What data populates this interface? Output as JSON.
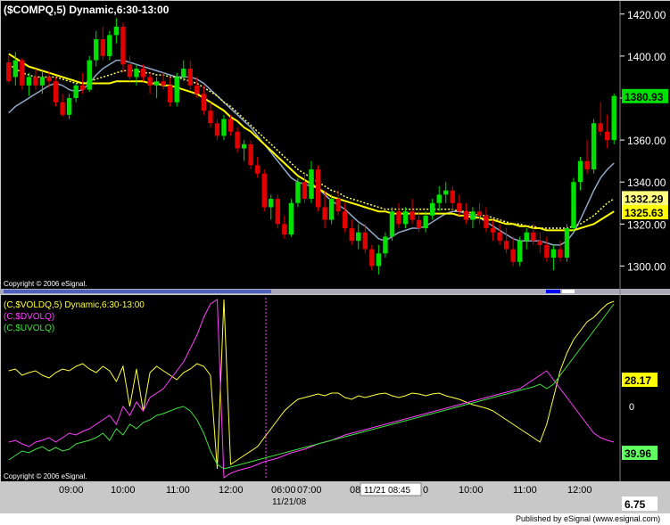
{
  "footer": {
    "published": "Published by eSignal (www.esignal.com)"
  },
  "chart_data": [
    {
      "type": "candlestick",
      "title": "($COMPQ,5) Dynamic,6:30-13:00",
      "copyright": "Copyright © 2006 eSignal.",
      "ylim": [
        1290,
        1425
      ],
      "y_ticks": [
        1300,
        1320,
        1340,
        1360,
        1380,
        1400,
        1420
      ],
      "y_tick_labels": [
        "1300.00",
        "1320.00",
        "1340.00",
        "1360.00",
        "1380.00",
        "1400.00",
        "1420.00"
      ],
      "price_labels": [
        {
          "text": "1380.93",
          "value": 1380.93,
          "bg": "#00e000",
          "fg": "#000000"
        },
        {
          "text": "1332.29",
          "value": 1332.29,
          "bg": "#ffff80",
          "fg": "#000000"
        },
        {
          "text": "1325.63",
          "value": 1325.63,
          "bg": "#ffff00",
          "fg": "#000000"
        }
      ],
      "candles": [
        [
          1397,
          1400,
          1387,
          1388
        ],
        [
          1390,
          1402,
          1386,
          1398
        ],
        [
          1398,
          1399,
          1384,
          1386
        ],
        [
          1386,
          1392,
          1381,
          1390
        ],
        [
          1390,
          1394,
          1384,
          1386
        ],
        [
          1386,
          1393,
          1382,
          1390
        ],
        [
          1390,
          1393,
          1385,
          1388
        ],
        [
          1388,
          1390,
          1376,
          1378
        ],
        [
          1378,
          1382,
          1371,
          1372
        ],
        [
          1372,
          1382,
          1370,
          1380
        ],
        [
          1380,
          1387,
          1378,
          1386
        ],
        [
          1386,
          1392,
          1382,
          1384
        ],
        [
          1384,
          1400,
          1383,
          1398
        ],
        [
          1398,
          1412,
          1395,
          1408
        ],
        [
          1408,
          1414,
          1398,
          1400
        ],
        [
          1400,
          1412,
          1398,
          1410
        ],
        [
          1410,
          1418,
          1406,
          1414
        ],
        [
          1414,
          1416,
          1392,
          1396
        ],
        [
          1396,
          1400,
          1388,
          1390
        ],
        [
          1390,
          1396,
          1386,
          1394
        ],
        [
          1394,
          1396,
          1388,
          1390
        ],
        [
          1390,
          1392,
          1382,
          1386
        ],
        [
          1386,
          1390,
          1380,
          1388
        ],
        [
          1388,
          1392,
          1384,
          1386
        ],
        [
          1386,
          1390,
          1376,
          1378
        ],
        [
          1378,
          1392,
          1376,
          1390
        ],
        [
          1390,
          1398,
          1388,
          1394
        ],
        [
          1394,
          1398,
          1384,
          1386
        ],
        [
          1386,
          1390,
          1380,
          1382
        ],
        [
          1382,
          1386,
          1372,
          1374
        ],
        [
          1374,
          1378,
          1366,
          1368
        ],
        [
          1368,
          1370,
          1360,
          1362
        ],
        [
          1362,
          1372,
          1360,
          1370
        ],
        [
          1370,
          1372,
          1362,
          1364
        ],
        [
          1364,
          1366,
          1354,
          1356
        ],
        [
          1356,
          1360,
          1350,
          1358
        ],
        [
          1358,
          1360,
          1346,
          1348
        ],
        [
          1348,
          1352,
          1342,
          1344
        ],
        [
          1344,
          1346,
          1326,
          1328
        ],
        [
          1328,
          1334,
          1322,
          1332
        ],
        [
          1332,
          1334,
          1318,
          1320
        ],
        [
          1320,
          1324,
          1313,
          1315
        ],
        [
          1315,
          1332,
          1314,
          1330
        ],
        [
          1330,
          1342,
          1328,
          1340
        ],
        [
          1340,
          1344,
          1330,
          1332
        ],
        [
          1332,
          1350,
          1330,
          1346
        ],
        [
          1346,
          1348,
          1326,
          1328
        ],
        [
          1328,
          1336,
          1318,
          1322
        ],
        [
          1322,
          1334,
          1320,
          1332
        ],
        [
          1332,
          1336,
          1324,
          1326
        ],
        [
          1326,
          1330,
          1316,
          1318
        ],
        [
          1318,
          1322,
          1310,
          1312
        ],
        [
          1312,
          1320,
          1308,
          1316
        ],
        [
          1316,
          1320,
          1306,
          1308
        ],
        [
          1308,
          1310,
          1298,
          1300
        ],
        [
          1300,
          1310,
          1296,
          1306
        ],
        [
          1306,
          1316,
          1304,
          1314
        ],
        [
          1314,
          1328,
          1312,
          1326
        ],
        [
          1326,
          1330,
          1318,
          1320
        ],
        [
          1320,
          1328,
          1318,
          1326
        ],
        [
          1326,
          1332,
          1320,
          1322
        ],
        [
          1322,
          1326,
          1316,
          1318
        ],
        [
          1318,
          1326,
          1316,
          1324
        ],
        [
          1324,
          1332,
          1322,
          1330
        ],
        [
          1330,
          1338,
          1326,
          1334
        ],
        [
          1334,
          1340,
          1330,
          1336
        ],
        [
          1336,
          1338,
          1326,
          1330
        ],
        [
          1330,
          1334,
          1324,
          1326
        ],
        [
          1326,
          1330,
          1320,
          1322
        ],
        [
          1322,
          1328,
          1318,
          1326
        ],
        [
          1326,
          1330,
          1320,
          1324
        ],
        [
          1324,
          1328,
          1316,
          1318
        ],
        [
          1318,
          1322,
          1312,
          1316
        ],
        [
          1316,
          1320,
          1310,
          1312
        ],
        [
          1312,
          1318,
          1306,
          1308
        ],
        [
          1308,
          1314,
          1300,
          1302
        ],
        [
          1302,
          1314,
          1300,
          1312
        ],
        [
          1312,
          1318,
          1308,
          1316
        ],
        [
          1316,
          1320,
          1310,
          1312
        ],
        [
          1312,
          1316,
          1306,
          1310
        ],
        [
          1310,
          1314,
          1302,
          1304
        ],
        [
          1304,
          1310,
          1298,
          1308
        ],
        [
          1308,
          1312,
          1302,
          1304
        ],
        [
          1304,
          1320,
          1302,
          1318
        ],
        [
          1318,
          1342,
          1316,
          1340
        ],
        [
          1340,
          1352,
          1336,
          1350
        ],
        [
          1350,
          1360,
          1344,
          1346
        ],
        [
          1346,
          1370,
          1344,
          1368
        ],
        [
          1368,
          1378,
          1362,
          1364
        ],
        [
          1364,
          1372,
          1356,
          1360
        ],
        [
          1360,
          1382,
          1358,
          1381
        ]
      ],
      "ma_fast": [
        1373,
        1376,
        1378,
        1380,
        1382,
        1384,
        1386,
        1387,
        1386,
        1384,
        1383,
        1384,
        1387,
        1391,
        1394,
        1396,
        1398,
        1398,
        1397,
        1396,
        1395,
        1394,
        1393,
        1392,
        1391,
        1390,
        1390,
        1390,
        1389,
        1387,
        1384,
        1381,
        1378,
        1375,
        1372,
        1369,
        1366,
        1362,
        1358,
        1354,
        1350,
        1346,
        1342,
        1340,
        1339,
        1338,
        1337,
        1334,
        1331,
        1329,
        1327,
        1324,
        1321,
        1319,
        1316,
        1313,
        1312,
        1314,
        1316,
        1317,
        1318,
        1318,
        1319,
        1321,
        1323,
        1325,
        1326,
        1326,
        1325,
        1324,
        1323,
        1321,
        1319,
        1317,
        1315,
        1313,
        1312,
        1312,
        1312,
        1312,
        1311,
        1310,
        1310,
        1312,
        1316,
        1322,
        1329,
        1336,
        1342,
        1346,
        1349
      ],
      "ma_mid_dotted": [
        1396,
        1394,
        1392,
        1391,
        1390,
        1390,
        1390,
        1390,
        1389,
        1388,
        1387,
        1387,
        1388,
        1389,
        1390,
        1391,
        1392,
        1393,
        1393,
        1393,
        1392,
        1392,
        1391,
        1391,
        1390,
        1390,
        1389,
        1388,
        1387,
        1385,
        1383,
        1381,
        1378,
        1376,
        1373,
        1370,
        1367,
        1364,
        1361,
        1358,
        1355,
        1352,
        1349,
        1346,
        1344,
        1342,
        1340,
        1338,
        1336,
        1335,
        1333,
        1332,
        1331,
        1330,
        1329,
        1328,
        1327,
        1327,
        1327,
        1327,
        1327,
        1327,
        1327,
        1327,
        1327,
        1327,
        1327,
        1326,
        1326,
        1325,
        1324,
        1324,
        1323,
        1322,
        1321,
        1320,
        1320,
        1319,
        1319,
        1318,
        1318,
        1318,
        1318,
        1318,
        1319,
        1320,
        1322,
        1324,
        1327,
        1330,
        1332
      ],
      "ma_slow": [
        1401,
        1399,
        1397,
        1395,
        1394,
        1393,
        1392,
        1391,
        1390,
        1389,
        1388,
        1387,
        1387,
        1387,
        1387,
        1387,
        1388,
        1388,
        1388,
        1388,
        1388,
        1387,
        1387,
        1386,
        1386,
        1385,
        1384,
        1383,
        1382,
        1380,
        1378,
        1376,
        1374,
        1371,
        1369,
        1366,
        1364,
        1361,
        1358,
        1355,
        1352,
        1349,
        1346,
        1343,
        1341,
        1339,
        1337,
        1335,
        1333,
        1332,
        1331,
        1330,
        1329,
        1328,
        1327,
        1326,
        1326,
        1325,
        1325,
        1325,
        1325,
        1325,
        1325,
        1325,
        1325,
        1325,
        1325,
        1324,
        1324,
        1323,
        1323,
        1322,
        1322,
        1321,
        1320,
        1320,
        1319,
        1319,
        1318,
        1318,
        1317,
        1317,
        1317,
        1317,
        1317,
        1318,
        1319,
        1320,
        1322,
        1324,
        1326
      ]
    },
    {
      "type": "line",
      "title": "(C,$VOLDQ,5) Dynamic,6:30-13:00",
      "copyright": "Copyright © 2006 eSignal.",
      "ylim": [
        -100,
        100
      ],
      "y_tick_labels": [
        "0"
      ],
      "value_labels": [
        {
          "text": "28.17",
          "bg": "#ffff00",
          "fg": "#000000"
        },
        {
          "text": "39.96",
          "bg": "#60ff60",
          "fg": "#000000"
        },
        {
          "text": "6.75",
          "bg": "#ffffff",
          "fg": "#000000"
        }
      ],
      "series": [
        {
          "name": "(C,$VOLDQ,5) Dynamic,6:30-13:00",
          "color": "#ffff40",
          "values": [
            20,
            22,
            15,
            18,
            20,
            15,
            12,
            18,
            22,
            20,
            25,
            28,
            22,
            18,
            25,
            20,
            8,
            25,
            -20,
            22,
            -25,
            18,
            25,
            20,
            15,
            10,
            18,
            22,
            28,
            25,
            15,
            -90,
            100,
            -85,
            -80,
            -75,
            -70,
            -65,
            -55,
            -45,
            -35,
            -25,
            -18,
            -12,
            -10,
            -8,
            -6,
            -8,
            -5,
            -5,
            -10,
            -12,
            -8,
            -10,
            -8,
            -6,
            -5,
            -8,
            -10,
            -8,
            -5,
            -6,
            -8,
            -6,
            -5,
            -8,
            -10,
            -12,
            -15,
            -18,
            -20,
            -22,
            -25,
            -30,
            -35,
            -40,
            -45,
            -50,
            -55,
            -60,
            -40,
            -10,
            20,
            40,
            55,
            65,
            75,
            80,
            88,
            95,
            98
          ]
        },
        {
          "name": "(C,$DVOLQ)",
          "color": "#ff40ff",
          "values": [
            -60,
            -58,
            -62,
            -65,
            -60,
            -58,
            -55,
            -60,
            -55,
            -50,
            -52,
            -48,
            -45,
            -40,
            -35,
            -30,
            -40,
            -20,
            -30,
            -15,
            -25,
            -10,
            -5,
            0,
            10,
            20,
            30,
            45,
            60,
            80,
            95,
            100,
            -100,
            -95,
            -92,
            -90,
            -88,
            -85,
            -82,
            -80,
            -78,
            -75,
            -72,
            -70,
            -68,
            -65,
            -62,
            -60,
            -58,
            -55,
            -52,
            -50,
            -48,
            -46,
            -44,
            -42,
            -40,
            -38,
            -36,
            -34,
            -32,
            -30,
            -28,
            -26,
            -24,
            -22,
            -20,
            -18,
            -16,
            -14,
            -12,
            -10,
            -8,
            -6,
            -4,
            -2,
            0,
            5,
            10,
            15,
            20,
            10,
            0,
            -10,
            -20,
            -30,
            -40,
            -50,
            -55,
            -58,
            -60
          ]
        },
        {
          "name": "(C,$UVOLQ)",
          "color": "#40e040",
          "values": [
            -80,
            -75,
            -70,
            -72,
            -68,
            -65,
            -70,
            -66,
            -70,
            -68,
            -62,
            -60,
            -58,
            -55,
            -50,
            -58,
            -45,
            -52,
            -40,
            -45,
            -38,
            -35,
            -30,
            -28,
            -25,
            -22,
            -20,
            -25,
            -35,
            -50,
            -70,
            -85,
            -90,
            -88,
            -86,
            -84,
            -82,
            -80,
            -78,
            -76,
            -74,
            -72,
            -70,
            -68,
            -66,
            -64,
            -62,
            -60,
            -58,
            -56,
            -54,
            -52,
            -50,
            -48,
            -46,
            -44,
            -42,
            -40,
            -38,
            -36,
            -34,
            -32,
            -30,
            -28,
            -26,
            -24,
            -22,
            -20,
            -18,
            -16,
            -14,
            -12,
            -10,
            -8,
            -6,
            -4,
            -2,
            0,
            2,
            5,
            0,
            5,
            15,
            25,
            35,
            45,
            55,
            65,
            75,
            85,
            95
          ]
        }
      ]
    }
  ],
  "time_axis": {
    "labels": [
      "09:00",
      "10:00",
      "11:00",
      "12:00",
      "06:00",
      "07:00",
      "08",
      "0",
      "10:00",
      "11:00",
      "12:00"
    ],
    "date_label": "11/21/08",
    "cursor_label": "11/21 08:45"
  }
}
